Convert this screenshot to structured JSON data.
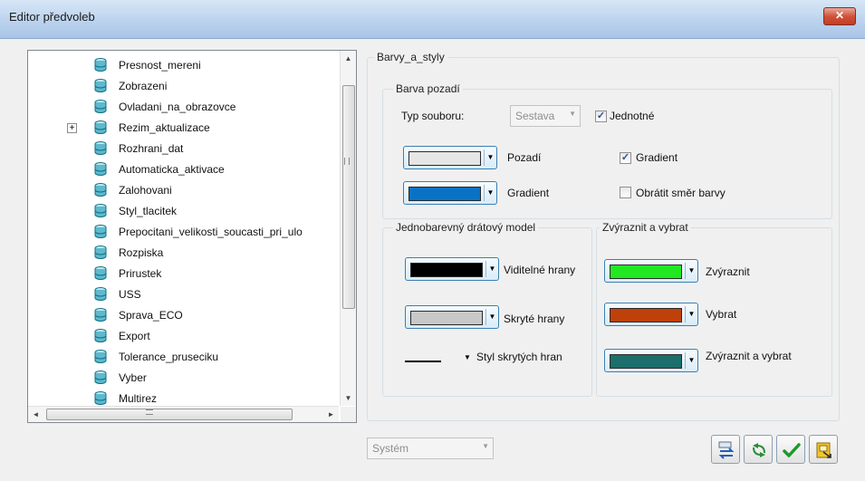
{
  "window": {
    "title": "Editor předvoleb",
    "close_glyph": "✕"
  },
  "tree": {
    "items": [
      {
        "label": "Presnost_mereni",
        "icon": "database-icon"
      },
      {
        "label": "Zobrazeni",
        "icon": "database-icon"
      },
      {
        "label": "Ovladani_na_obrazovce",
        "icon": "database-icon"
      },
      {
        "label": "Rezim_aktualizace",
        "icon": "database-icon",
        "expander": "+"
      },
      {
        "label": "Rozhrani_dat",
        "icon": "database-icon"
      },
      {
        "label": "Automaticka_aktivace",
        "icon": "database-icon"
      },
      {
        "label": "Zalohovani",
        "icon": "database-icon"
      },
      {
        "label": "Styl_tlacitek",
        "icon": "database-icon"
      },
      {
        "label": "Prepocitani_velikosti_soucasti_pri_ulo",
        "icon": "database-icon"
      },
      {
        "label": "Rozpiska",
        "icon": "database-icon"
      },
      {
        "label": "Prirustek",
        "icon": "database-icon"
      },
      {
        "label": "USS",
        "icon": "database-icon"
      },
      {
        "label": "Sprava_ECO",
        "icon": "database-icon"
      },
      {
        "label": "Export",
        "icon": "database-icon"
      },
      {
        "label": "Tolerance_pruseciku",
        "icon": "database-icon"
      },
      {
        "label": "Vyber",
        "icon": "database-icon"
      },
      {
        "label": "Multirez",
        "icon": "database-icon"
      }
    ],
    "scroll_up": "▲",
    "scroll_down": "▼",
    "scroll_left": "◄",
    "scroll_right": "►",
    "hscroll_grip": "III",
    "vscroll_grip": "III"
  },
  "panel": {
    "group_title": "Barvy_a_styly",
    "background": {
      "title": "Barva pozadí",
      "file_type_label": "Typ souboru:",
      "file_type_value": "Sestava",
      "uniform_label": "Jednotné",
      "uniform_checked": true,
      "background_label": "Pozadí",
      "background_color": "#e6e6e6",
      "gradient_label": "Gradient",
      "gradient_color": "#0a72c5",
      "gradient_check_label": "Gradient",
      "gradient_checked": true,
      "reverse_label": "Obrátit směr barvy",
      "reverse_checked": false
    },
    "wireframe": {
      "title": "Jednobarevný drátový model",
      "visible_edges_label": "Viditelné hrany",
      "visible_edges_color": "#000000",
      "hidden_edges_label": "Skryté hrany",
      "hidden_edges_color": "#c8c8c8",
      "hidden_style_label": "Styl skrytých hran"
    },
    "highlight": {
      "title": "Zvýraznit a vybrat",
      "highlight_label": "Zvýraznit",
      "highlight_color": "#21e821",
      "select_label": "Vybrat",
      "select_color": "#c0400a",
      "highlight_select_label": "Zvýraznit a vybrat",
      "highlight_select_color": "#1c6f6a"
    }
  },
  "footer": {
    "system_value": "Systém",
    "buttons": [
      "transfer-icon",
      "recycle-icon",
      "checkmark-icon",
      "export-file-icon"
    ]
  },
  "colors": {
    "accent": "#3c7fb1",
    "check": "#2a4f9c"
  }
}
